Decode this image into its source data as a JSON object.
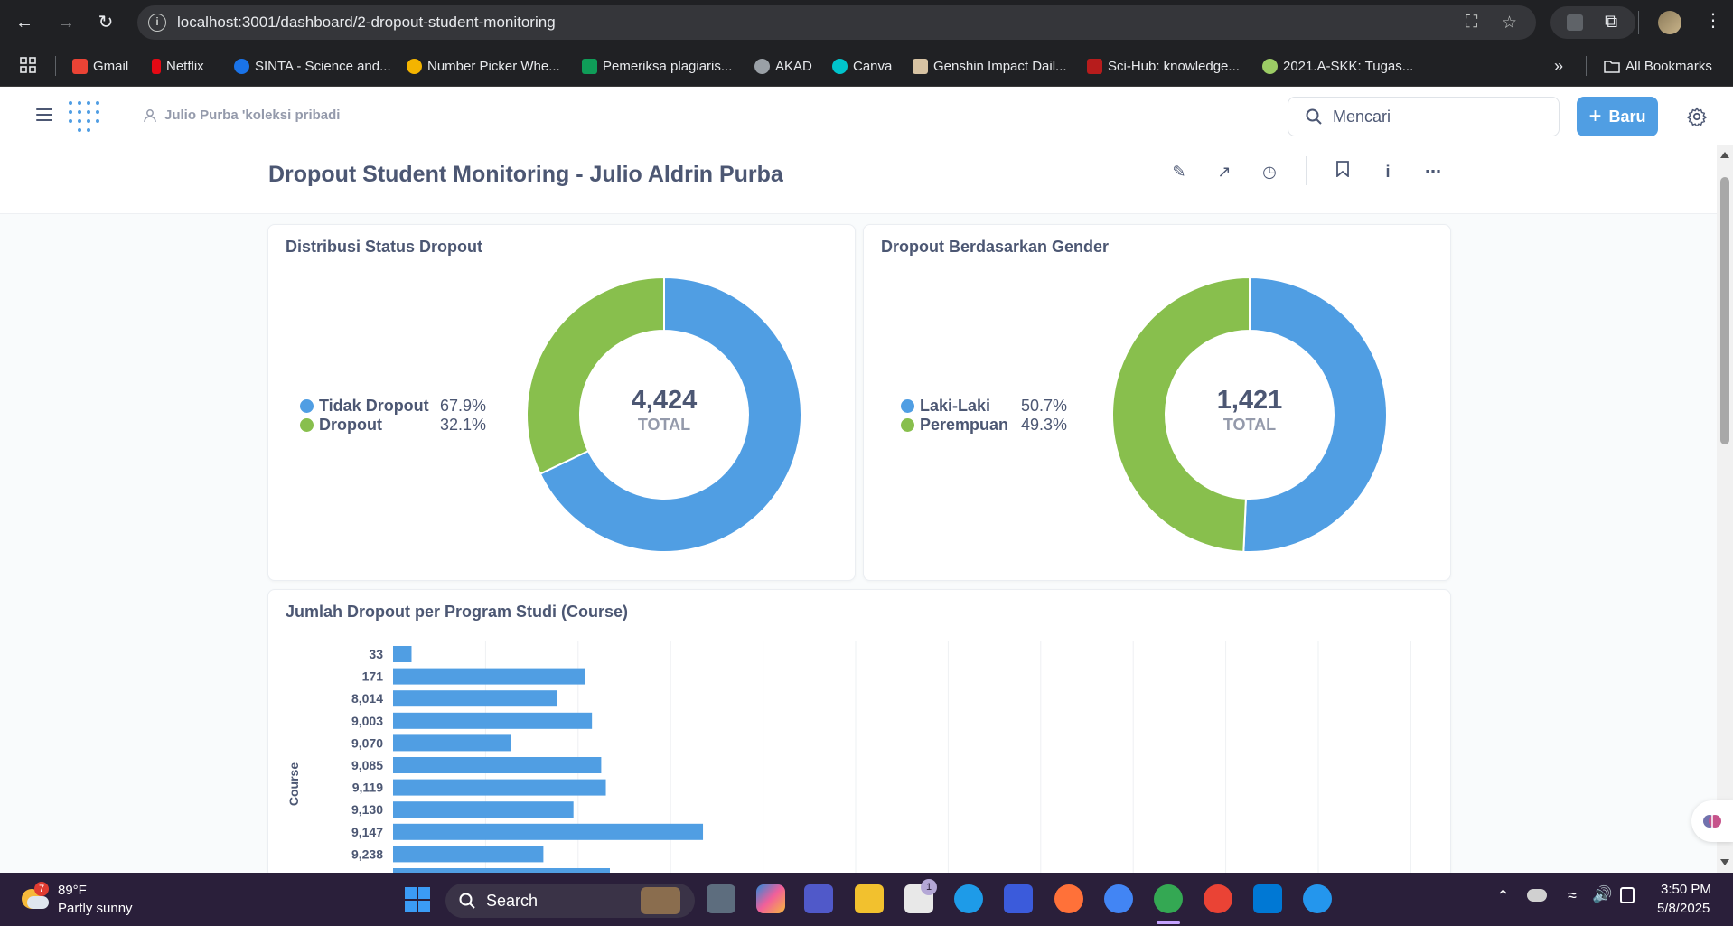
{
  "browser": {
    "url": "localhost:3001/dashboard/2-dropout-student-monitoring",
    "bookmarks": [
      {
        "label": "Gmail",
        "color": "#ea4335"
      },
      {
        "label": "Netflix",
        "color": "#e50914"
      },
      {
        "label": "SINTA - Science and...",
        "color": "#1a73e8"
      },
      {
        "label": "Number Picker Whe...",
        "color": "#f4b400"
      },
      {
        "label": "Pemeriksa plagiaris...",
        "color": "#0f9d58"
      },
      {
        "label": "AKAD",
        "color": "#9aa0a6"
      },
      {
        "label": "Canva",
        "color": "#00c4cc"
      },
      {
        "label": "Genshin Impact Dail...",
        "color": "#d7c3a3"
      },
      {
        "label": "Sci-Hub: knowledge...",
        "color": "#b71c1c"
      },
      {
        "label": "2021.A-SKK: Tugas...",
        "color": "#9ccc65"
      }
    ],
    "all_bookmarks": "All Bookmarks"
  },
  "app": {
    "collection": "Julio Purba 'koleksi pribadi",
    "search_placeholder": "Mencari",
    "new_label": "Baru"
  },
  "dashboard": {
    "title": "Dropout Student Monitoring - Julio Aldrin Purba"
  },
  "cards": {
    "status": {
      "title": "Distribusi Status Dropout",
      "total": "4,424",
      "total_label": "TOTAL",
      "legend": [
        {
          "name": "Tidak Dropout",
          "value": "67.9%",
          "color": "#509ee3"
        },
        {
          "name": "Dropout",
          "value": "32.1%",
          "color": "#88bf4d"
        }
      ]
    },
    "gender": {
      "title": "Dropout Berdasarkan Gender",
      "total": "1,421",
      "total_label": "TOTAL",
      "legend": [
        {
          "name": "Laki-Laki",
          "value": "50.7%",
          "color": "#509ee3"
        },
        {
          "name": "Perempuan",
          "value": "49.3%",
          "color": "#88bf4d"
        }
      ]
    },
    "course": {
      "title": "Jumlah Dropout per Program Studi (Course)",
      "ylabel": "Course"
    }
  },
  "chart_data": [
    {
      "type": "pie",
      "title": "Distribusi Status Dropout",
      "categories": [
        "Tidak Dropout",
        "Dropout"
      ],
      "values": [
        67.9,
        32.1
      ],
      "total": 4424
    },
    {
      "type": "pie",
      "title": "Dropout Berdasarkan Gender",
      "categories": [
        "Laki-Laki",
        "Perempuan"
      ],
      "values": [
        50.7,
        49.3
      ],
      "total": 1421
    },
    {
      "type": "bar",
      "title": "Jumlah Dropout per Program Studi (Course)",
      "ylabel": "Course",
      "orientation": "horizontal",
      "categories": [
        "33",
        "171",
        "8,014",
        "9,003",
        "9,070",
        "9,085",
        "9,119",
        "9,130",
        "9,147",
        "9,238"
      ],
      "values": [
        8,
        83,
        71,
        86,
        51,
        90,
        92,
        78,
        134,
        65
      ],
      "xlim": [
        0,
        450
      ]
    }
  ],
  "taskbar": {
    "temp": "89°F",
    "weather": "Partly sunny",
    "weather_badge": "7",
    "search": "Search",
    "time": "3:50 PM",
    "date": "5/8/2025",
    "store_badge": "1"
  }
}
